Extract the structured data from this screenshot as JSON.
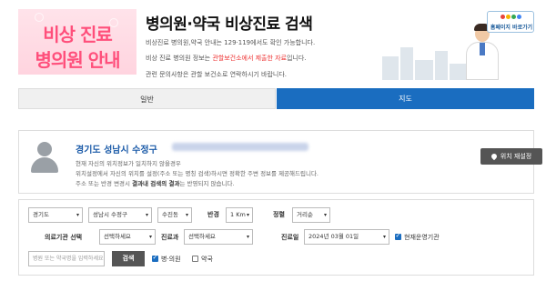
{
  "header": {
    "banner_line1": "비상 진료",
    "banner_line2": "병의원 안내",
    "title": "병의원·약국 비상진료 검색",
    "desc_line1": "비상진료 병의원,약국 안내는 129·119에서도 확인 가능합니다.",
    "desc_line2_pre": "비상 진료 병의원 정보는 ",
    "desc_line2_red": "관할보건소에서 제출한 자료",
    "desc_line2_post": "입니다.",
    "desc_line3": "관련 문의사항은 관할 보건소로 연락하시기 바랍니다.",
    "home_button_label": "홈페이지 바로가기"
  },
  "tabs": {
    "general": "일반",
    "map": "지도"
  },
  "location": {
    "name": "경기도 성남시 수정구",
    "notice_line1": "현재 자신의 위치정보가 일치하지 않을경우",
    "notice_line2": "위치설정에서 자신의 위치를 설정(주소 또는 명칭 검색)하시면 정확한 주변 정보를 제공해드립니다.",
    "notice_line3_pre": "주소 또는 반경 변경시 ",
    "notice_line3_bold": "결과내 검색의 결과",
    "notice_line3_post": "는 반영되지 않습니다.",
    "reset_button": "위치 재설정"
  },
  "search": {
    "sido": "경기도",
    "sigungu": "성남시 수정구",
    "dong": "수진동",
    "radius_label": "반경",
    "radius_value": "1 Km",
    "sort_label": "정렬",
    "sort_value": "거리순",
    "institution_label": "의료기관 선택",
    "institution_value": "선택하세요",
    "department_label": "진료과",
    "department_value": "선택하세요",
    "date_label": "진료일",
    "date_value": "2024년 03월 01일",
    "open_now_label": "현재운영기관",
    "open_now_checked": true,
    "keyword_placeholder": "병원 또는 약국명을 입력하세요",
    "search_button": "검색",
    "hospital_label": "병·의원",
    "hospital_checked": true,
    "pharmacy_label": "약국",
    "pharmacy_checked": false
  },
  "colors": {
    "primary_blue": "#1a6dc0",
    "banner_pink": "#ff4f7b",
    "highlight_red": "#e33333",
    "button_dark": "#555555"
  }
}
